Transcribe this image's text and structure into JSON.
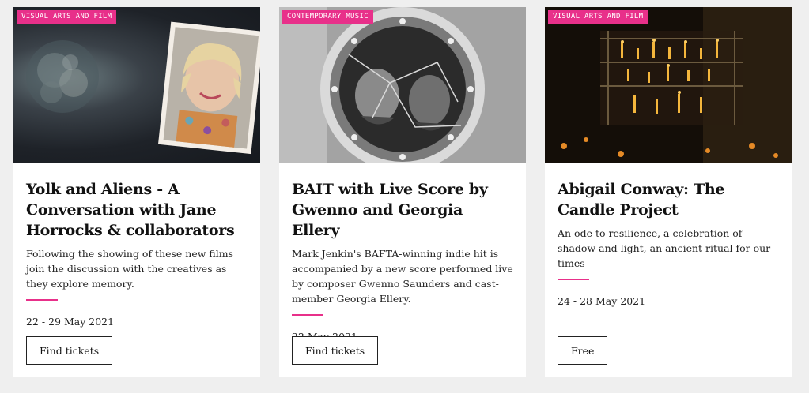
{
  "cards": [
    {
      "tag": "VISUAL ARTS AND FILM",
      "title": "Yolk and Aliens - A Conversation with Jane Horrocks & collaborators",
      "description": "Following the showing of these new films join the discussion with the creatives as they explore memory.",
      "date": "22 - 29 May 2021",
      "button": "Find tickets"
    },
    {
      "tag": "CONTEMPORARY MUSIC",
      "title": "BAIT with Live Score by Gwenno and Georgia Ellery",
      "description": "Mark Jenkin's BAFTA-winning indie hit is accompanied by a new score performed live by composer Gwenno Saunders and cast-member Georgia Ellery.",
      "date": "22 May 2021",
      "button": "Find tickets"
    },
    {
      "tag": "VISUAL ARTS AND FILM",
      "title": "Abigail Conway: The Candle Project",
      "description": "An ode to resilience, a celebration of shadow and light, an ancient ritual for our times",
      "date": "24 - 28 May 2021",
      "button": "Free"
    }
  ],
  "colors": {
    "accent": "#e8308a",
    "background": "#efefef",
    "card": "#ffffff"
  }
}
